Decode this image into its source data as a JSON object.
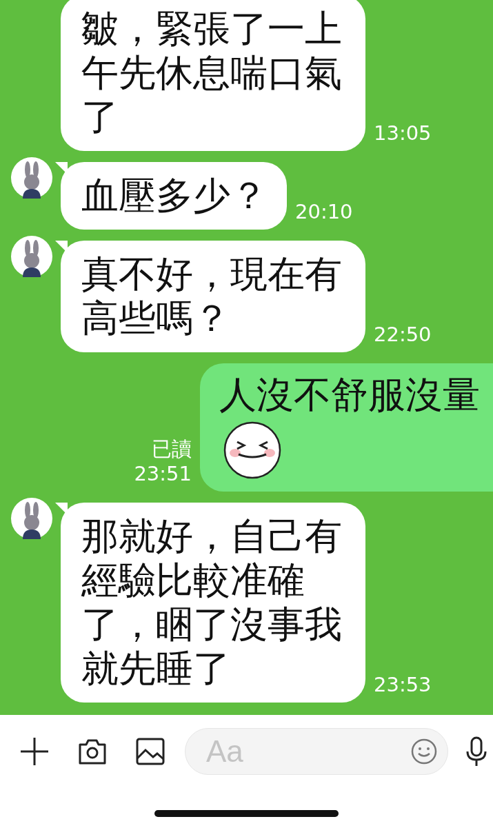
{
  "messages": [
    {
      "kind": "incoming",
      "avatar_visible": false,
      "text": "皺，緊張了一上午先休息喘口氣了",
      "time": "13:05"
    },
    {
      "kind": "incoming",
      "avatar_visible": true,
      "text": "血壓多少？",
      "time": "20:10"
    },
    {
      "kind": "incoming",
      "avatar_visible": true,
      "text": "真不好，現在有高些嗎？",
      "time": "22:50"
    },
    {
      "kind": "outgoing",
      "text": "人沒不舒服沒量",
      "sticker": true,
      "read_label": "已讀",
      "time": "23:51"
    },
    {
      "kind": "incoming",
      "avatar_visible": true,
      "text": "那就好，自己有經驗比較准確了，睏了沒事我就先睡了",
      "time": "23:53"
    }
  ],
  "composer": {
    "placeholder": "Aa"
  }
}
